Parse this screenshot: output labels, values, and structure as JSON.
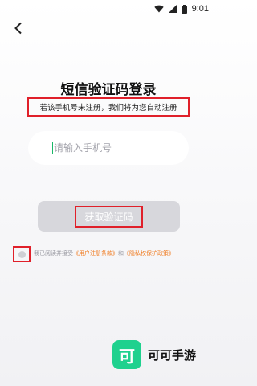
{
  "status_bar": {
    "time": "9:01",
    "icons": [
      "wifi-icon",
      "signal-icon",
      "battery-icon"
    ]
  },
  "nav": {
    "back_icon": "chevron-left-icon"
  },
  "login": {
    "title": "短信验证码登录",
    "subtitle": "若该手机号未注册，我们将为您自动注册",
    "phone_placeholder": "请输入手机号",
    "phone_value": "",
    "get_code_label": "获取验证码"
  },
  "agreement": {
    "checked": false,
    "prefix": "我已阅读并接受",
    "terms_link": "《用户注册条款》",
    "and": "和",
    "privacy_link": "《隐私权保护政策》"
  },
  "brand": {
    "logo_char": "可",
    "name": "可可手游",
    "logo_color": "#1fd18e"
  },
  "colors": {
    "accent_link": "#f07a1e",
    "highlight_box": "#e0202a",
    "button_disabled": "#d7d7dc",
    "caret": "#18b766"
  }
}
